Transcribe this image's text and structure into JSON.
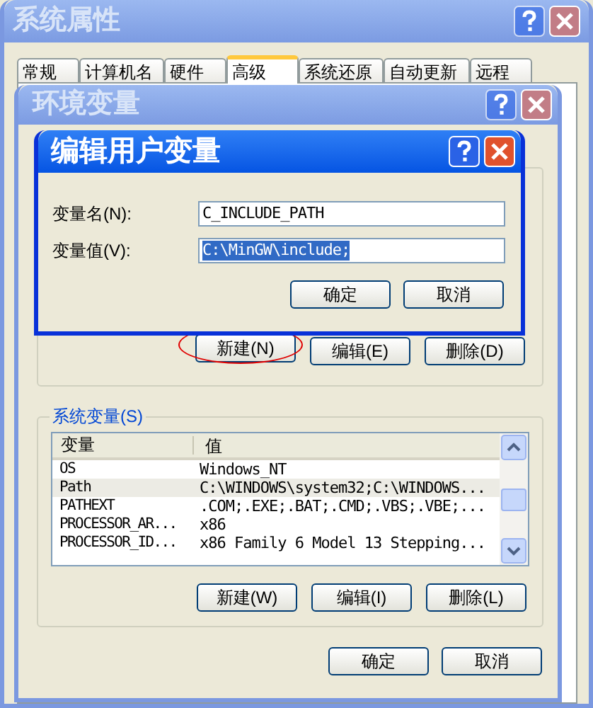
{
  "system_properties": {
    "title": "系统属性",
    "active": false,
    "tabs": [
      {
        "label": "常规",
        "selected": false
      },
      {
        "label": "计算机名",
        "selected": false
      },
      {
        "label": "硬件",
        "selected": false
      },
      {
        "label": "高级",
        "selected": true
      },
      {
        "label": "系统还原",
        "selected": false
      },
      {
        "label": "自动更新",
        "selected": false
      },
      {
        "label": "远程",
        "selected": false
      }
    ]
  },
  "environment_variables": {
    "title": "环境变量",
    "active": false,
    "user_buttons": [
      {
        "label": "新建(N)",
        "circled": true
      },
      {
        "label": "编辑(E)",
        "circled": false
      },
      {
        "label": "删除(D)",
        "circled": false
      }
    ],
    "system_variables": {
      "title": "系统变量(S)",
      "columns": [
        "变量",
        "值"
      ],
      "rows": [
        {
          "name": "OS",
          "value": "Windows_NT",
          "selected": false
        },
        {
          "name": "Path",
          "value": "C:\\WINDOWS\\system32;C:\\WINDOWS...",
          "selected": true
        },
        {
          "name": "PATHEXT",
          "value": ".COM;.EXE;.BAT;.CMD;.VBS;.VBE;...",
          "selected": false
        },
        {
          "name": "PROCESSOR_AR...",
          "value": "x86",
          "selected": false
        },
        {
          "name": "PROCESSOR_ID...",
          "value": "x86 Family 6 Model 13 Stepping...",
          "selected": false
        }
      ]
    },
    "system_buttons": [
      {
        "label": "新建(W)",
        "circled": false
      },
      {
        "label": "编辑(I)",
        "circled": false
      },
      {
        "label": "删除(L)",
        "circled": false
      }
    ],
    "buttons": [
      "确定",
      "取消"
    ]
  },
  "edit_user_variable": {
    "title": "编辑用户变量",
    "active": true,
    "fields": [
      {
        "label": "变量名(N):",
        "value": "C_INCLUDE_PATH",
        "selected": false
      },
      {
        "label": "变量值(V):",
        "value": "C:\\MinGW\\include;",
        "selected": true
      }
    ],
    "buttons": [
      "确定",
      "取消"
    ]
  }
}
